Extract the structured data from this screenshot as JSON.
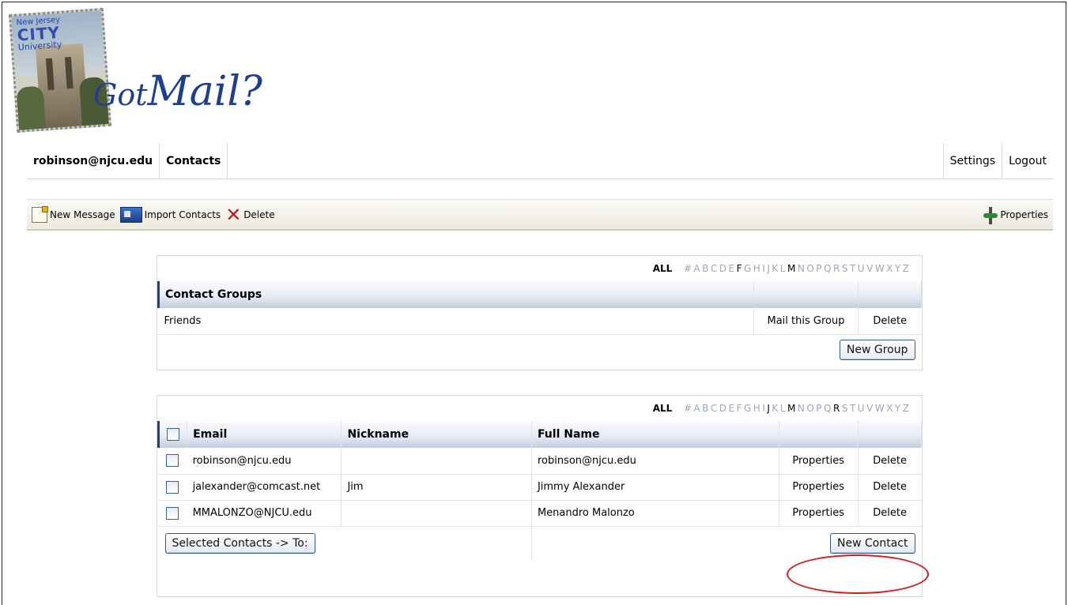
{
  "logo": {
    "stamp_line1": "New Jersey",
    "stamp_line2": "CITY",
    "stamp_line3": "University",
    "brand_part1": "Got",
    "brand_part2": "Mail?"
  },
  "nav": {
    "user": "robinson@njcu.edu",
    "section": "Contacts",
    "settings": "Settings",
    "logout": "Logout"
  },
  "toolbar": {
    "new_message": "New Message",
    "import_contacts": "Import Contacts",
    "delete": "Delete",
    "properties": "Properties"
  },
  "groups_panel": {
    "alpha_all": "ALL",
    "alpha_letters": [
      "#",
      "A",
      "B",
      "C",
      "D",
      "E",
      "F",
      "G",
      "H",
      "I",
      "J",
      "K",
      "L",
      "M",
      "N",
      "O",
      "P",
      "Q",
      "R",
      "S",
      "T",
      "U",
      "V",
      "W",
      "X",
      "Y",
      "Z"
    ],
    "alpha_active": [
      "F",
      "M"
    ],
    "header": "Contact Groups",
    "groups": [
      {
        "name": "Friends",
        "mail_label": "Mail this Group",
        "delete_label": "Delete"
      }
    ],
    "new_group_button": "New Group"
  },
  "contacts_panel": {
    "alpha_all": "ALL",
    "alpha_letters": [
      "#",
      "A",
      "B",
      "C",
      "D",
      "E",
      "F",
      "G",
      "H",
      "I",
      "J",
      "K",
      "L",
      "M",
      "N",
      "O",
      "P",
      "Q",
      "R",
      "S",
      "T",
      "U",
      "V",
      "W",
      "X",
      "Y",
      "Z"
    ],
    "alpha_active": [
      "J",
      "M",
      "R"
    ],
    "columns": {
      "email": "Email",
      "nickname": "Nickname",
      "full_name": "Full Name"
    },
    "contacts": [
      {
        "email": "robinson@njcu.edu",
        "nickname": "",
        "full_name": "robinson@njcu.edu",
        "properties_label": "Properties",
        "delete_label": "Delete"
      },
      {
        "email": "jalexander@comcast.net",
        "nickname": "Jim",
        "full_name": "Jimmy Alexander",
        "properties_label": "Properties",
        "delete_label": "Delete"
      },
      {
        "email": "MMALONZO@NJCU.edu",
        "nickname": "",
        "full_name": "Menandro Malonzo",
        "properties_label": "Properties",
        "delete_label": "Delete"
      }
    ],
    "selected_to_button": "Selected Contacts -> To:",
    "new_contact_button": "New Contact"
  },
  "colors": {
    "brand_blue": "#1e3f8f",
    "highlight_red": "#e01818",
    "alpha_inactive": "#9ba6ba"
  }
}
